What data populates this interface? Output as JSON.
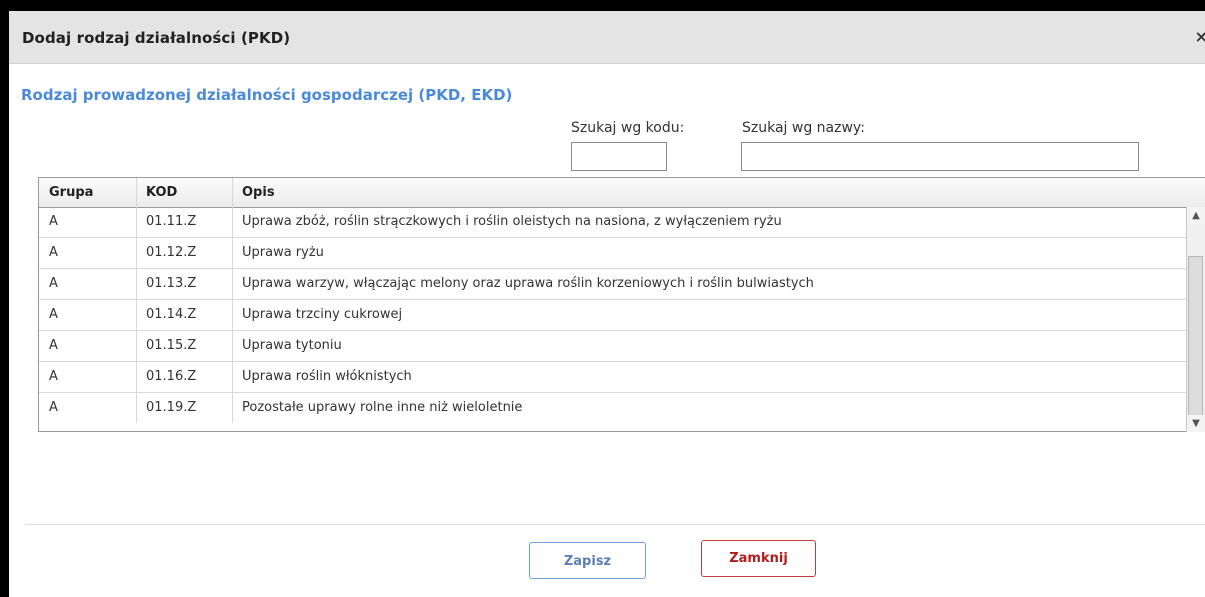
{
  "dialog": {
    "title": "Dodaj rodzaj działalności (PKD)",
    "close_glyph": "×"
  },
  "section": {
    "title": "Rodzaj prowadzonej działalności gospodarczej (PKD, EKD)"
  },
  "search": {
    "code_label": "Szukaj wg kodu:",
    "code_value": "",
    "name_label": "Szukaj wg nazwy:",
    "name_value": ""
  },
  "table": {
    "headers": [
      "Grupa",
      "KOD",
      "Opis"
    ],
    "rows": [
      {
        "grupa": "A",
        "kod": "01.11.Z",
        "opis": "Uprawa zbóż, roślin strączkowych i roślin oleistych na nasiona, z wyłączeniem ryżu"
      },
      {
        "grupa": "A",
        "kod": "01.12.Z",
        "opis": "Uprawa ryżu"
      },
      {
        "grupa": "A",
        "kod": "01.13.Z",
        "opis": "Uprawa warzyw, włączając melony oraz uprawa roślin korzeniowych i roślin bulwiastych"
      },
      {
        "grupa": "A",
        "kod": "01.14.Z",
        "opis": "Uprawa trzciny cukrowej"
      },
      {
        "grupa": "A",
        "kod": "01.15.Z",
        "opis": "Uprawa tytoniu"
      },
      {
        "grupa": "A",
        "kod": "01.16.Z",
        "opis": "Uprawa roślin włóknistych"
      },
      {
        "grupa": "A",
        "kod": "01.19.Z",
        "opis": "Pozostałe uprawy rolne inne niż wieloletnie"
      }
    ],
    "scroll_up_glyph": "▲",
    "scroll_down_glyph": "▼"
  },
  "buttons": {
    "save_label": "Zapisz",
    "close_label": "Zamknij"
  },
  "colors": {
    "section_title": "#4a8ad8",
    "save_border": "#6ea0d8",
    "close_border": "#c43a3a"
  }
}
